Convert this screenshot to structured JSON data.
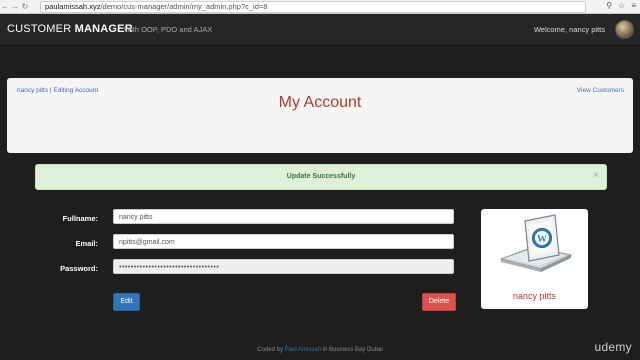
{
  "browser": {
    "url_host": "paulamissah.xyz",
    "url_path": "/demo/cus-manager/admin/my_admin.php?c_id=8"
  },
  "navbar": {
    "brand_light": "CUSTOMER",
    "brand_bold": "MANAGER",
    "tagline": "With OOP, PDO and AJAX",
    "welcome": "Welcome, nancy pitts"
  },
  "panel": {
    "breadcrumb": "nancy pitts | Editing Account",
    "view_link": "View Customers",
    "title": "My Account"
  },
  "alert": {
    "message": "Update Successfully",
    "close": "×"
  },
  "form": {
    "fullname_label": "Fullname:",
    "fullname_value": "nancy pitts",
    "email_label": "Email:",
    "email_value": "npitts@gmail.com",
    "password_label": "Password:",
    "password_value": "••••••••••••••••••••••••••••••••••",
    "edit_label": "Edit",
    "delete_label": "Delete"
  },
  "profile_card": {
    "name": "nancy pitts",
    "icon": "wordpress-laptop-icon"
  },
  "footer": {
    "prefix": "Coded by",
    "author": "Paul Amissah",
    "suffix": "in Business Bay Dubai"
  },
  "watermark": "udemy"
}
